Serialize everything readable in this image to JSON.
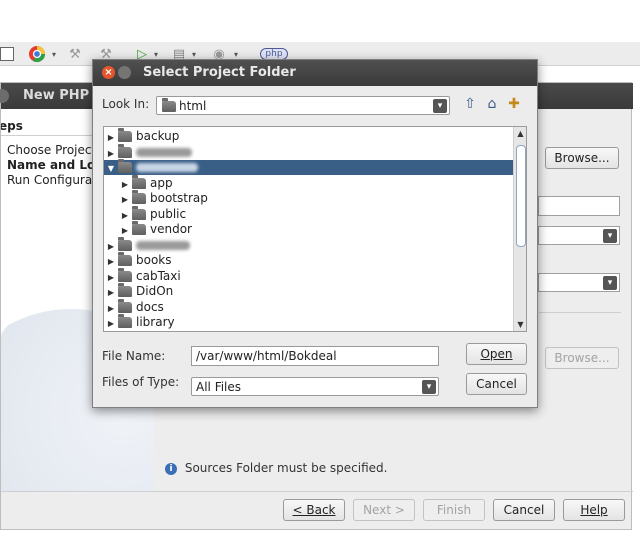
{
  "toolbar": {
    "php_badge": "php"
  },
  "wizard": {
    "title": "New PHP P",
    "steps_heading": "eps",
    "steps": [
      "Choose Project",
      "Name and Lo",
      "Run Configurati"
    ],
    "browse_label": "Browse...",
    "browse_label_2": "Browse...",
    "info_message": "Sources Folder must be specified.",
    "buttons": {
      "back": "< Back",
      "next": "Next >",
      "finish": "Finish",
      "cancel": "Cancel",
      "help": "Help"
    }
  },
  "dialog": {
    "title": "Select Project Folder",
    "look_in_label": "Look In:",
    "look_in_value": "html",
    "tree": [
      {
        "label": "backup",
        "level": 0,
        "expanded": false
      },
      {
        "label": "",
        "level": 0,
        "expanded": false,
        "obscured": true
      },
      {
        "label": "",
        "level": 0,
        "expanded": true,
        "selected": true,
        "obscured": true
      },
      {
        "label": "app",
        "level": 1,
        "expanded": false
      },
      {
        "label": "bootstrap",
        "level": 1,
        "expanded": false
      },
      {
        "label": "public",
        "level": 1,
        "expanded": false
      },
      {
        "label": "vendor",
        "level": 1,
        "expanded": false
      },
      {
        "label": "",
        "level": 0,
        "expanded": false,
        "obscured": true
      },
      {
        "label": "books",
        "level": 0,
        "expanded": false
      },
      {
        "label": "cabTaxi",
        "level": 0,
        "expanded": false
      },
      {
        "label": "DidOn",
        "level": 0,
        "expanded": false
      },
      {
        "label": "docs",
        "level": 0,
        "expanded": false
      },
      {
        "label": "library",
        "level": 0,
        "expanded": false
      }
    ],
    "file_name_label": "File Name:",
    "file_name_value": "/var/www/html/Bokdeal",
    "files_of_type_label": "Files of Type:",
    "files_of_type_value": "All Files",
    "open_label": "Open",
    "cancel_label": "Cancel"
  }
}
